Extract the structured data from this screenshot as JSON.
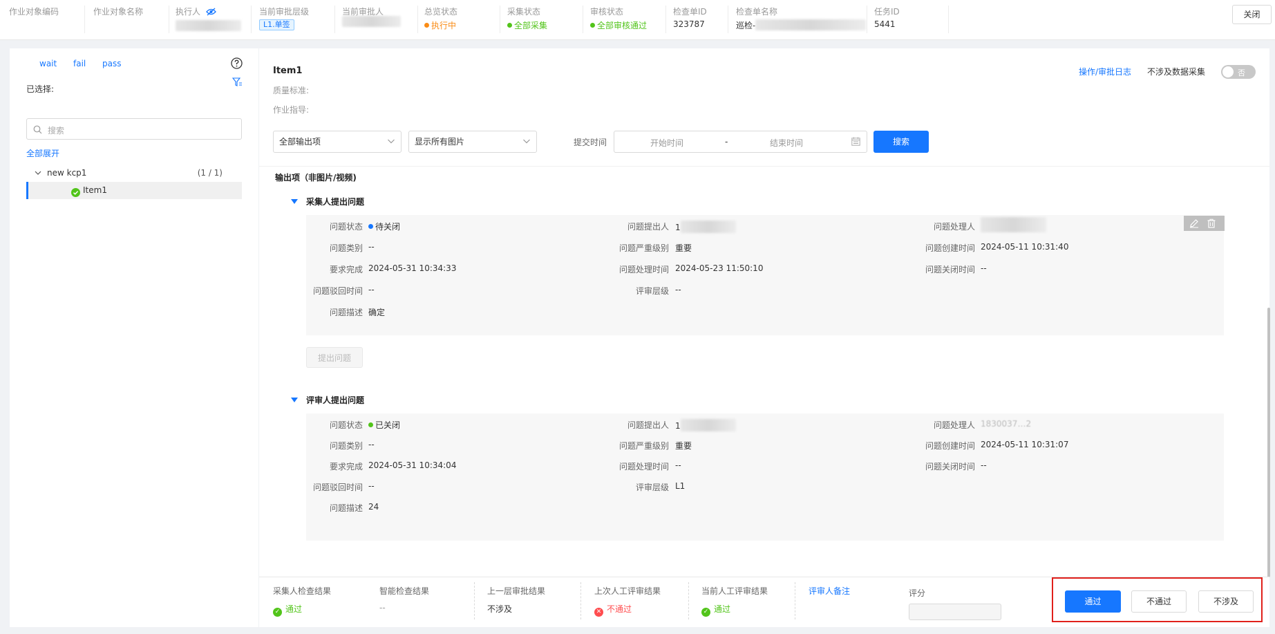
{
  "topbar": {
    "cols": [
      {
        "label": "作业对象编码",
        "value": ""
      },
      {
        "label": "作业对象名称",
        "value": ""
      },
      {
        "label": "执行人",
        "value": ""
      },
      {
        "label": "当前审批层级",
        "value": "L1.单签"
      },
      {
        "label": "当前审批人",
        "value": ""
      },
      {
        "label": "总览状态",
        "value": "执行中"
      },
      {
        "label": "采集状态",
        "value": "全部采集"
      },
      {
        "label": "审核状态",
        "value": "全部审核通过"
      },
      {
        "label": "检查单ID",
        "value": "323787"
      },
      {
        "label": "检查单名称",
        "value": "巡检-"
      },
      {
        "label": "任务ID",
        "value": "5441"
      }
    ],
    "close_label": "关闭"
  },
  "left": {
    "filters": [
      "wait",
      "fail",
      "pass"
    ],
    "selected_label": "已选择:",
    "search_placeholder": "搜索",
    "expand_all": "全部展开",
    "tree": {
      "group_label": "new kcp1",
      "group_count": "(1 / 1)",
      "item_label": "Item1"
    }
  },
  "main": {
    "title": "Item1",
    "quality_label": "质量标准:",
    "guide_label": "作业指导:",
    "log_link": "操作/审批日志",
    "no_collect_label": "不涉及数据采集",
    "toggle_text": "否",
    "filter1": "全部输出项",
    "filter2": "显示所有图片",
    "submit_time_label": "提交时间",
    "start_placeholder": "开始时间",
    "date_sep": "-",
    "end_placeholder": "结束时间",
    "search_btn": "搜索",
    "output_title": "输出项（非图片/视频)",
    "collector_section": {
      "title": "采集人提出问题",
      "fields": {
        "status_label": "问题状态",
        "status_value": "待关闭",
        "proposer_label": "问题提出人",
        "proposer_value": "1",
        "handler_label": "问题处理人",
        "handler_value": "",
        "type_label": "问题类别",
        "type_value": "--",
        "severity_label": "问题严重级别",
        "severity_value": "重要",
        "created_label": "问题创建时间",
        "created_value": "2024-05-11 10:31:40",
        "required_label": "要求完成",
        "required_value": "2024-05-31 10:34:33",
        "handled_label": "问题处理时间",
        "handled_value": "2024-05-23 11:50:10",
        "closed_label": "问题关闭时间",
        "closed_value": "--",
        "rejected_label": "问题驳回时间",
        "rejected_value": "--",
        "level_label": "评审层级",
        "level_value": "--",
        "desc_label": "问题描述",
        "desc_value": "确定"
      },
      "raise_btn": "提出问题"
    },
    "reviewer_section": {
      "title": "评审人提出问题",
      "fields": {
        "status_label": "问题状态",
        "status_value": "已关闭",
        "proposer_label": "问题提出人",
        "proposer_value": "1",
        "handler_label": "问题处理人",
        "handler_value": "1830037…2",
        "type_label": "问题类别",
        "type_value": "--",
        "severity_label": "问题严重级别",
        "severity_value": "重要",
        "created_label": "问题创建时间",
        "created_value": "2024-05-11 10:31:07",
        "required_label": "要求完成",
        "required_value": "2024-05-31 10:34:04",
        "handled_label": "问题处理时间",
        "handled_value": "--",
        "closed_label": "问题关闭时间",
        "closed_value": "--",
        "rejected_label": "问题驳回时间",
        "rejected_value": "--",
        "level_label": "评审层级",
        "level_value": "L1",
        "desc_label": "问题描述",
        "desc_value": "24"
      }
    }
  },
  "bottom": {
    "collector_result_label": "采集人检查结果",
    "collector_result_value": "通过",
    "smart_result_label": "智能检查结果",
    "smart_result_value": "--",
    "prev_approval_label": "上一层审批结果",
    "prev_approval_value": "不涉及",
    "last_manual_label": "上次人工评审结果",
    "last_manual_value": "不通过",
    "cur_manual_label": "当前人工评审结果",
    "cur_manual_value": "通过",
    "reviewer_note_label": "评审人备注",
    "score_label": "评分",
    "pass_btn": "通过",
    "fail_btn": "不通过",
    "na_btn": "不涉及"
  },
  "colors": {
    "accent": "#1677ff",
    "success": "#52c41a",
    "warning": "#fa8c16",
    "danger": "#ff4d4f",
    "highlight_box": "#e0201b"
  },
  "icons": [
    "eye-slash-icon",
    "help-icon",
    "filter-icon",
    "search-icon",
    "chevron-down-icon",
    "check-circle-icon",
    "calendar-icon",
    "edit-icon",
    "delete-icon",
    "close-circle-icon"
  ]
}
